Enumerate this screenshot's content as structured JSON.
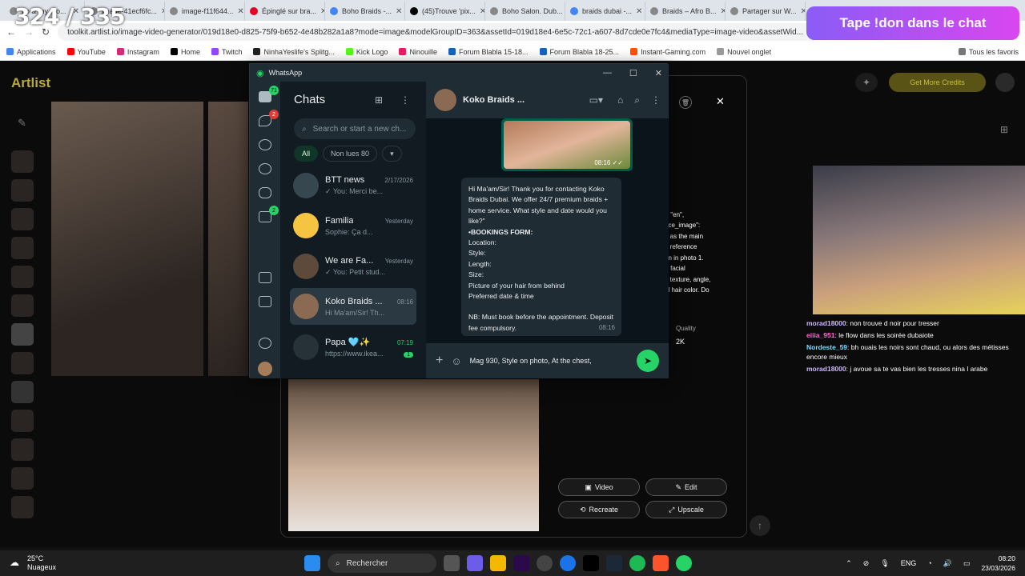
{
  "browser": {
    "tabs": [
      {
        "label": "bo & my mo..."
      },
      {
        "label": "image-41ecf6fc..."
      },
      {
        "label": "image-f11f644..."
      },
      {
        "label": "Épinglé sur bra..."
      },
      {
        "label": "Boho Braids -..."
      },
      {
        "label": "(45)Trouve 'pix..."
      },
      {
        "label": "Boho Salon. Dub..."
      },
      {
        "label": "braids dubai -..."
      },
      {
        "label": "Braids – Afro B..."
      },
      {
        "label": "Partager sur W..."
      }
    ],
    "url": "toolkit.artlist.io/image-video-generator/019d18e0-d825-75f9-b652-4e48b282a1a8?mode=image&modelGroupID=363&assetId=019d18e4-6e5c-72c1-a607-8d7cde0e7fc4&mediaType=image-video&assetWid...",
    "bookmarks": [
      "Applications",
      "YouTube",
      "Instagram",
      "Home",
      "Twitch",
      "NinhaYeslife's Splitg...",
      "Kick Logo",
      "Ninouille",
      "Forum Blabla 15-18...",
      "Forum Blabla 18-25...",
      "Instant-Gaming.com",
      "Nouvel onglet"
    ],
    "all_bookmarks": "Tous les favoris"
  },
  "overlay": {
    "counter": "324 / 335",
    "donate": "Tape !don dans le chat"
  },
  "artlist": {
    "logo": "Artlist",
    "get_credits": "Get More Credits",
    "quality_label": "Quality",
    "quality_value": "2K",
    "json_lines": [
      "\":",
      "\": \"en\",",
      "nce_image\":",
      "1 as the main",
      "n reference",
      "on in photo 1.",
      "), facial",
      "n texture, angle,",
      "al hair color. Do"
    ],
    "buttons": {
      "video": "Video",
      "edit": "Edit",
      "recreate": "Recreate",
      "upscale": "Upscale"
    }
  },
  "whatsapp": {
    "window_title": "WhatsApp",
    "rail_badges": {
      "chats": "71",
      "calls": "2",
      "communities": "2"
    },
    "list_title": "Chats",
    "search_placeholder": "Search or start a new ch...",
    "filters": {
      "all": "All",
      "unread": "Non lues 80"
    },
    "chats": [
      {
        "name": "BTT news",
        "time": "2/17/2026",
        "preview": "✓ You: Merci be..."
      },
      {
        "name": "Familia",
        "time": "Yesterday",
        "preview": "Sophie: Ça d..."
      },
      {
        "name": "We are Fa...",
        "time": "Yesterday",
        "preview": "✓ You: Petit stud..."
      },
      {
        "name": "Koko Braids ...",
        "time": "08:16",
        "preview": "Hi Ma'am/Sir! Th..."
      },
      {
        "name": "Papa 🩵✨",
        "time": "07:19",
        "preview": "https://www.ikea...",
        "unread": "1"
      }
    ],
    "conversation": {
      "name": "Koko Braids ...",
      "image_time": "08:16 ✓✓",
      "message_lines": [
        "Hi Ma'am/Sir! Thank you for contacting Koko Braids Dubai. We offer 24/7 premium braids + home service. What style and date would you like?\"",
        "•BOOKINGS FORM:",
        "Location:",
        "Style:",
        "Length:",
        "Size:",
        "Picture of your hair from behind",
        "Preferred date & time",
        "",
        "NB: Must book before the appointment. Deposit fee compulsory."
      ],
      "message_time": "08:16",
      "draft": "Mag 930, Style on photo, At the chest,"
    }
  },
  "stream_chat": [
    {
      "user": "morad18000",
      "text": "non trouve d noir pour tresser"
    },
    {
      "user": "eiiia_951",
      "text": "le flow dans les soirée dubaiote"
    },
    {
      "user": "Nordeste_59",
      "text": "bh ouais les noirs sont chaud, ou alors des métisses encore mieux"
    },
    {
      "user": "morad18000",
      "text": "j avoue sa te vas bien les tresses nina l arabe"
    }
  ],
  "taskbar": {
    "temp": "25°C",
    "weather": "Nuageux",
    "search": "Rechercher",
    "lang": "ENG",
    "time": "08:20",
    "date": "23/03/2026"
  }
}
